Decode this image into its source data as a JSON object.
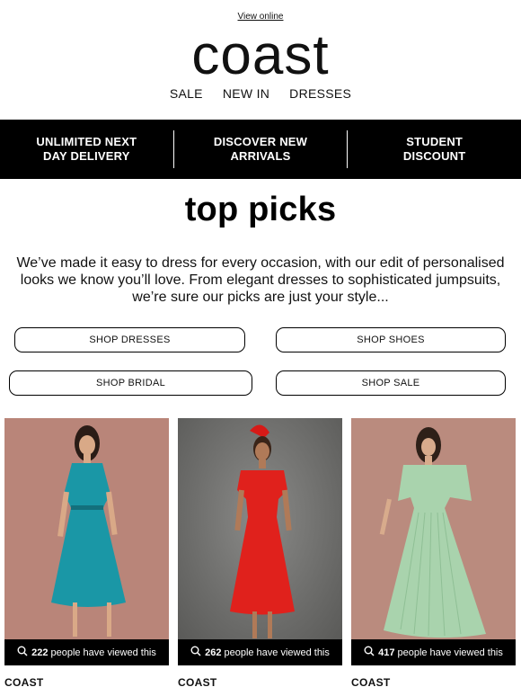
{
  "header": {
    "view_online": "View online",
    "logo": "coast",
    "nav": [
      "SALE",
      "NEW IN",
      "DRESSES"
    ]
  },
  "promo": [
    "UNLIMITED NEXT\nDAY DELIVERY",
    "DISCOVER NEW\nARRIVALS",
    "STUDENT\nDISCOUNT"
  ],
  "main": {
    "title": "top picks",
    "intro": "We’ve made it easy to dress for every occasion, with our edit of personalised looks we know you’ll love. From elegant dresses to sophisticated jumpsuits, we’re sure our picks are just your style...",
    "buttons": [
      "SHOP DRESSES",
      "SHOP SHOES",
      "SHOP BRIDAL",
      "SHOP SALE"
    ]
  },
  "products": [
    {
      "count": "222",
      "viewed_text": "people have viewed this",
      "brand": "COAST",
      "dress_color": "#1a97a6",
      "bg": "#b98579"
    },
    {
      "count": "262",
      "viewed_text": "people have viewed this",
      "brand": "COAST",
      "dress_color": "#e0211c",
      "bg": "#6e6e6c"
    },
    {
      "count": "417",
      "viewed_text": "people have viewed this",
      "brand": "COAST",
      "dress_color": "#a9d3ad",
      "bg": "#ba8b7e"
    }
  ]
}
